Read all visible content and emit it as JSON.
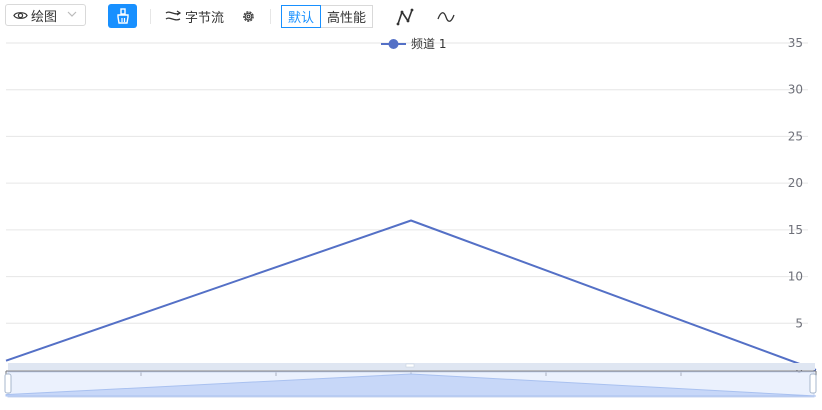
{
  "toolbar": {
    "view_select": {
      "label": "绘图",
      "icon": "eye-icon"
    },
    "clear_icon": "broom-icon",
    "byte_stream": {
      "label": "字节流",
      "icon": "flow-icon"
    },
    "settings_icon": "gear-icon",
    "mode_default": "默认",
    "mode_performance": "高性能",
    "line_mode_icon": "polyline-icon",
    "smooth_mode_icon": "wave-icon"
  },
  "colors": {
    "accent": "#1890ff",
    "series": "#5470c6",
    "grid": "#e6e6e6",
    "axis_text": "#6e7079"
  },
  "chart_data": {
    "type": "line",
    "x": [
      0,
      3,
      6
    ],
    "series": [
      {
        "name": "频道 1",
        "values": [
          1,
          16,
          0
        ]
      }
    ],
    "ylim": [
      0,
      35
    ],
    "yticks": [
      5,
      10,
      15,
      20,
      25,
      30,
      35
    ],
    "y_axis_position": "right",
    "grid": true,
    "legend_position": "top-center",
    "has_zoom_slider": true
  }
}
